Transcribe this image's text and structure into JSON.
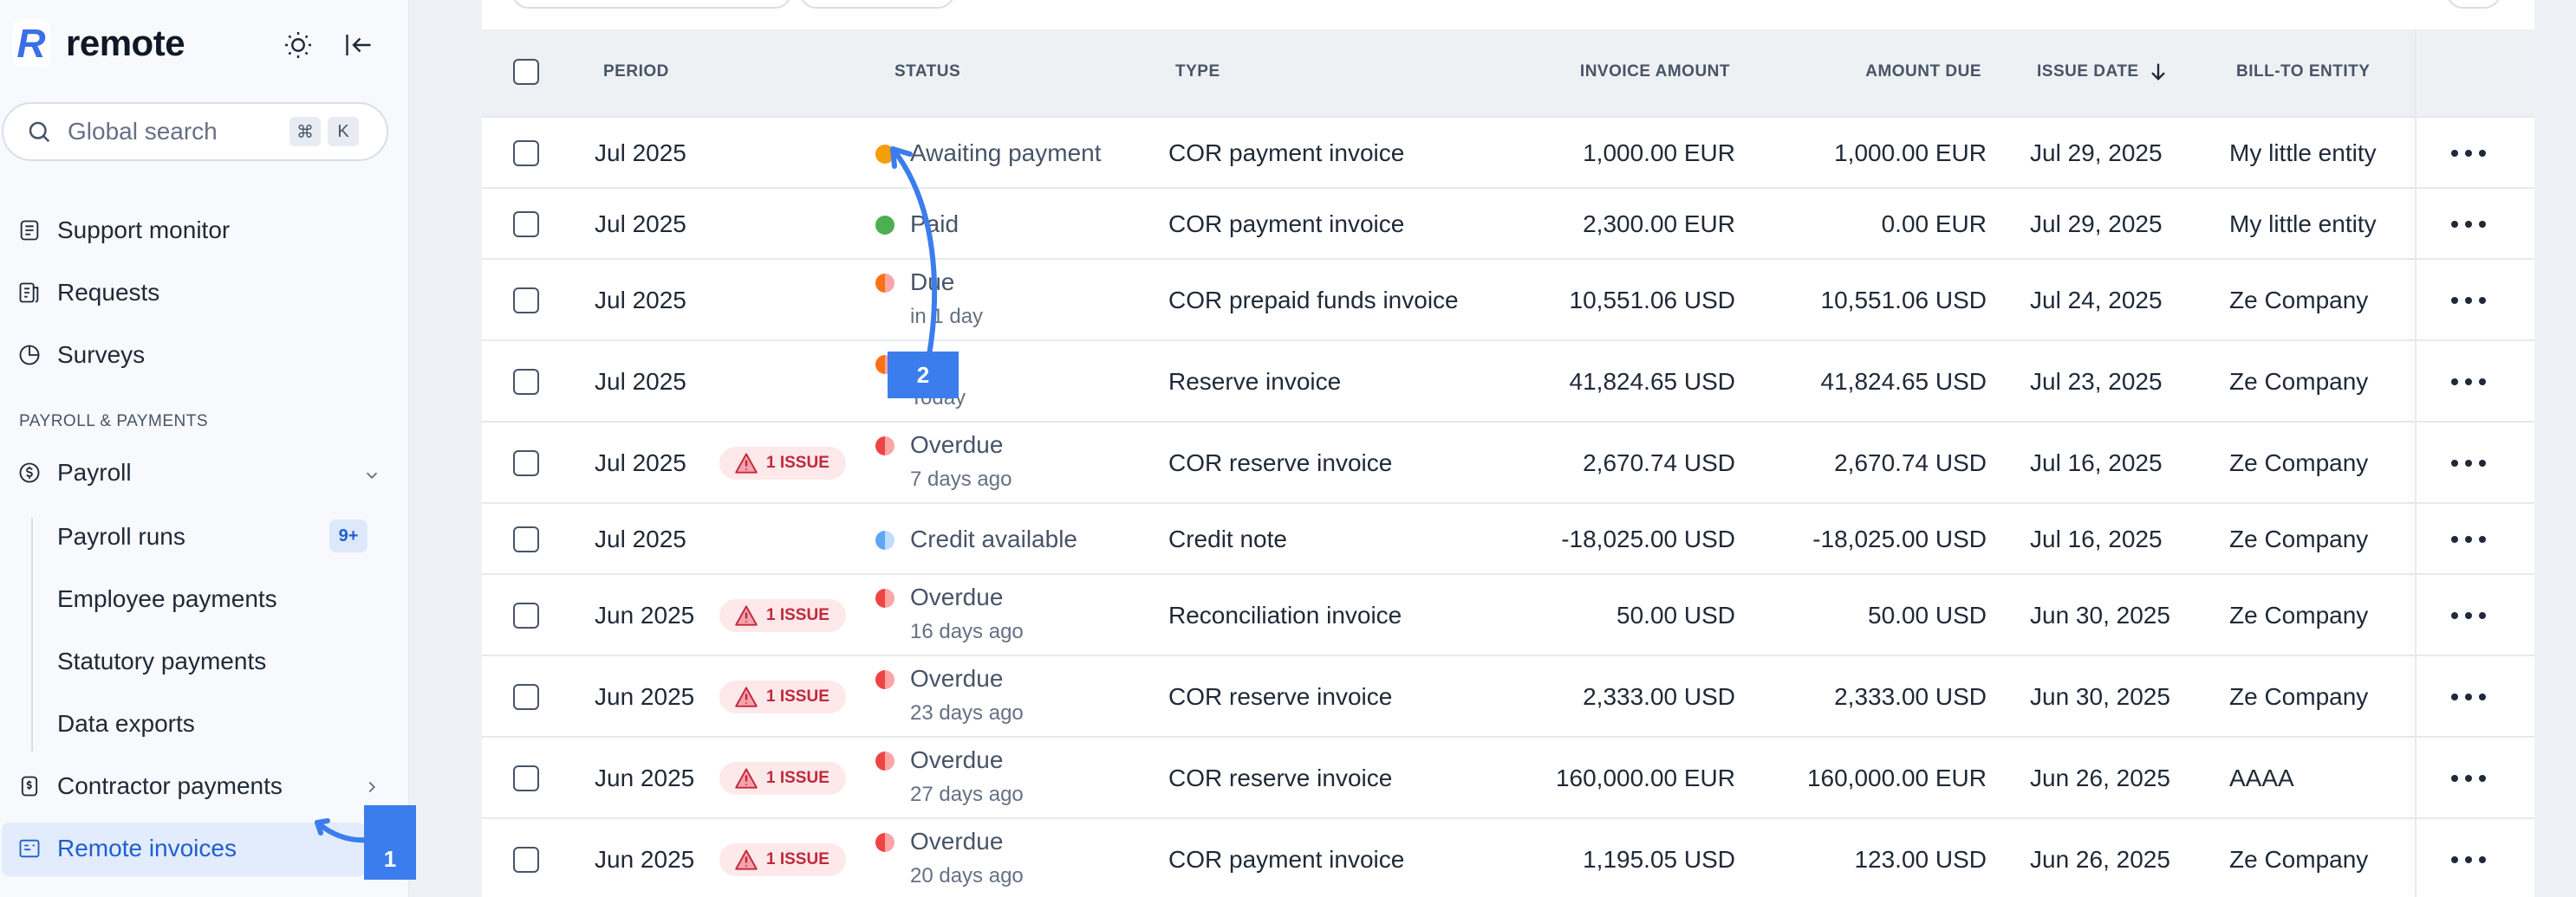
{
  "brand": {
    "name": "remote",
    "mark": "R"
  },
  "search": {
    "placeholder": "Global search",
    "kbd1": "⌘",
    "kbd2": "K"
  },
  "nav": {
    "support_monitor": "Support monitor",
    "requests": "Requests",
    "surveys": "Surveys",
    "section_payroll": "PAYROLL & PAYMENTS",
    "payroll": "Payroll",
    "payroll_runs": "Payroll runs",
    "payroll_runs_badge": "9+",
    "employee_payments": "Employee payments",
    "statutory_payments": "Statutory payments",
    "data_exports": "Data exports",
    "contractor_payments": "Contractor payments",
    "remote_invoices": "Remote invoices"
  },
  "table": {
    "headers": {
      "period": "PERIOD",
      "status": "STATUS",
      "type": "TYPE",
      "invoice_amount": "INVOICE AMOUNT",
      "amount_due": "AMOUNT DUE",
      "issue_date": "ISSUE DATE",
      "bill_to": "BILL-TO ENTITY"
    },
    "issue_label": "1 ISSUE",
    "rows": [
      {
        "period": "Jul 2025",
        "status": "Awaiting payment",
        "status_sub": "",
        "type": "COR payment invoice",
        "invoice_amount": "1,000.00 EUR",
        "amount_due": "1,000.00 EUR",
        "issue_date": "Jul 29, 2025",
        "bill_to": "My little entity"
      },
      {
        "period": "Jul 2025",
        "status": "Paid",
        "status_sub": "",
        "type": "COR payment invoice",
        "invoice_amount": "2,300.00 EUR",
        "amount_due": "0.00 EUR",
        "issue_date": "Jul 29, 2025",
        "bill_to": "My little entity"
      },
      {
        "period": "Jul 2025",
        "status": "Due",
        "status_sub": "in 1 day",
        "type": "COR prepaid funds invoice",
        "invoice_amount": "10,551.06 USD",
        "amount_due": "10,551.06 USD",
        "issue_date": "Jul 24, 2025",
        "bill_to": "Ze Company"
      },
      {
        "period": "Jul 2025",
        "status": "Due",
        "status_sub": "Today",
        "type": "Reserve invoice",
        "invoice_amount": "41,824.65 USD",
        "amount_due": "41,824.65 USD",
        "issue_date": "Jul 23, 2025",
        "bill_to": "Ze Company"
      },
      {
        "period": "Jul 2025",
        "status": "Overdue",
        "status_sub": "7 days ago",
        "type": "COR reserve invoice",
        "invoice_amount": "2,670.74 USD",
        "amount_due": "2,670.74 USD",
        "issue_date": "Jul 16, 2025",
        "bill_to": "Ze Company"
      },
      {
        "period": "Jul 2025",
        "status": "Credit available",
        "status_sub": "",
        "type": "Credit note",
        "invoice_amount": "-18,025.00 USD",
        "amount_due": "-18,025.00 USD",
        "issue_date": "Jul 16, 2025",
        "bill_to": "Ze Company"
      },
      {
        "period": "Jun 2025",
        "status": "Overdue",
        "status_sub": "16 days ago",
        "type": "Reconciliation invoice",
        "invoice_amount": "50.00 USD",
        "amount_due": "50.00 USD",
        "issue_date": "Jun 30, 2025",
        "bill_to": "Ze Company"
      },
      {
        "period": "Jun 2025",
        "status": "Overdue",
        "status_sub": "23 days ago",
        "type": "COR reserve invoice",
        "invoice_amount": "2,333.00 USD",
        "amount_due": "2,333.00 USD",
        "issue_date": "Jun 30, 2025",
        "bill_to": "Ze Company"
      },
      {
        "period": "Jun 2025",
        "status": "Overdue",
        "status_sub": "27 days ago",
        "type": "COR reserve invoice",
        "invoice_amount": "160,000.00 EUR",
        "amount_due": "160,000.00 EUR",
        "issue_date": "Jun 26, 2025",
        "bill_to": "AAAA"
      },
      {
        "period": "Jun 2025",
        "status": "Overdue",
        "status_sub": "20 days ago",
        "type": "COR payment invoice",
        "invoice_amount": "1,195.05 USD",
        "amount_due": "123.00 USD",
        "issue_date": "Jun 26, 2025",
        "bill_to": "Ze Company"
      }
    ]
  },
  "annotations": {
    "step1": "1",
    "step2": "2"
  },
  "colors": {
    "accent": "#3b7ded",
    "awaiting": "#f59e0b",
    "paid": "#4caf50",
    "due": "#f97316",
    "overdue": "#ef4444",
    "credit": "#60a5fa"
  }
}
